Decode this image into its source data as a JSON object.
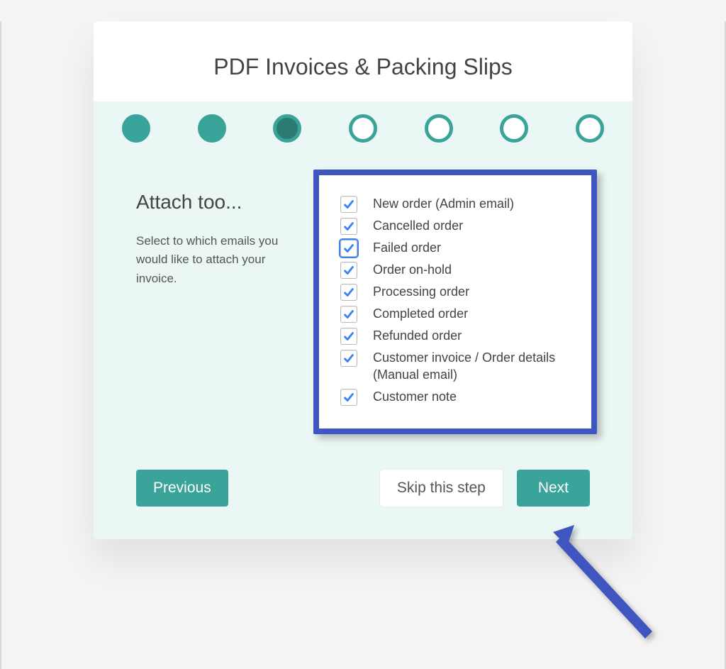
{
  "title": "PDF Invoices & Packing Slips",
  "steps": [
    {
      "state": "done"
    },
    {
      "state": "done"
    },
    {
      "state": "current"
    },
    {
      "state": "todo"
    },
    {
      "state": "todo"
    },
    {
      "state": "todo"
    },
    {
      "state": "todo"
    }
  ],
  "section": {
    "heading": "Attach too...",
    "description": "Select to which emails you would like to attach your invoice."
  },
  "options": [
    {
      "label": "New order (Admin email)",
      "checked": true,
      "focused": false
    },
    {
      "label": "Cancelled order",
      "checked": true,
      "focused": false
    },
    {
      "label": "Failed order",
      "checked": true,
      "focused": true
    },
    {
      "label": "Order on-hold",
      "checked": true,
      "focused": false
    },
    {
      "label": "Processing order",
      "checked": true,
      "focused": false
    },
    {
      "label": "Completed order",
      "checked": true,
      "focused": false
    },
    {
      "label": "Refunded order",
      "checked": true,
      "focused": false
    },
    {
      "label": "Customer invoice / Order details (Manual email)",
      "checked": true,
      "focused": false
    },
    {
      "label": "Customer note",
      "checked": true,
      "focused": false
    }
  ],
  "buttons": {
    "previous": "Previous",
    "skip": "Skip this step",
    "next": "Next"
  },
  "colors": {
    "accent": "#3aa39a",
    "highlight_border": "#3f56c1",
    "check": "#3b82f6"
  }
}
